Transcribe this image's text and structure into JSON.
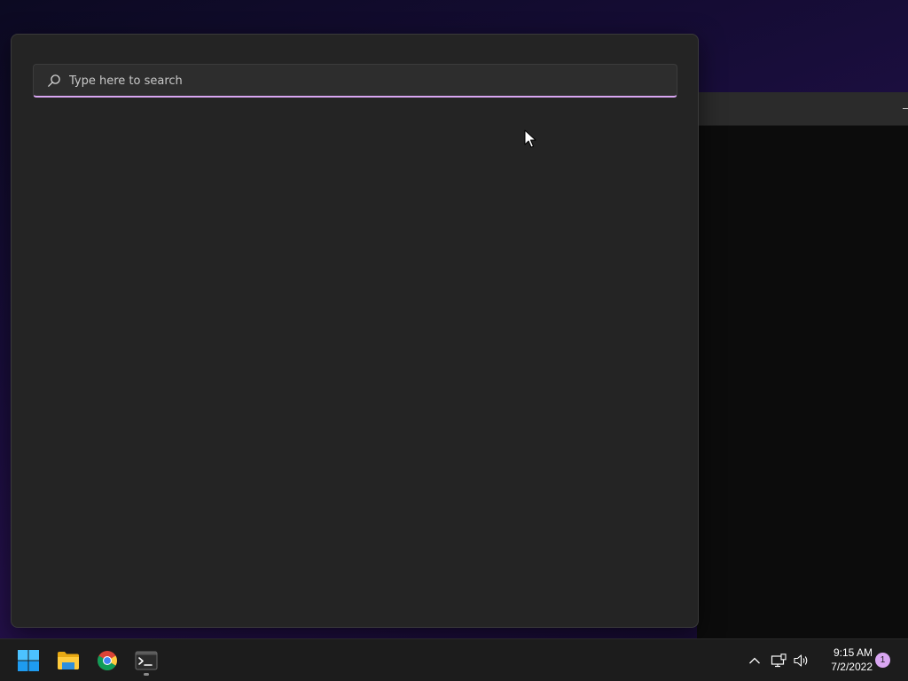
{
  "search": {
    "placeholder": "Type here to search",
    "value": "",
    "icon": "search-icon"
  },
  "taskbar": {
    "apps": [
      {
        "name": "Start",
        "icon": "windows-logo-icon"
      },
      {
        "name": "File Explorer",
        "icon": "folder-icon"
      },
      {
        "name": "Google Chrome",
        "icon": "chrome-icon"
      },
      {
        "name": "Terminal",
        "icon": "terminal-icon",
        "running": true
      }
    ],
    "tray": {
      "icons": [
        "chevron-up-icon",
        "network-icon",
        "volume-icon"
      ],
      "time": "9:15 AM",
      "date": "7/2/2022",
      "notification_count": "1"
    }
  },
  "colors": {
    "accent": "#d9a6f2",
    "flyout_bg": "#242424",
    "taskbar_bg": "#1c1c1c"
  }
}
